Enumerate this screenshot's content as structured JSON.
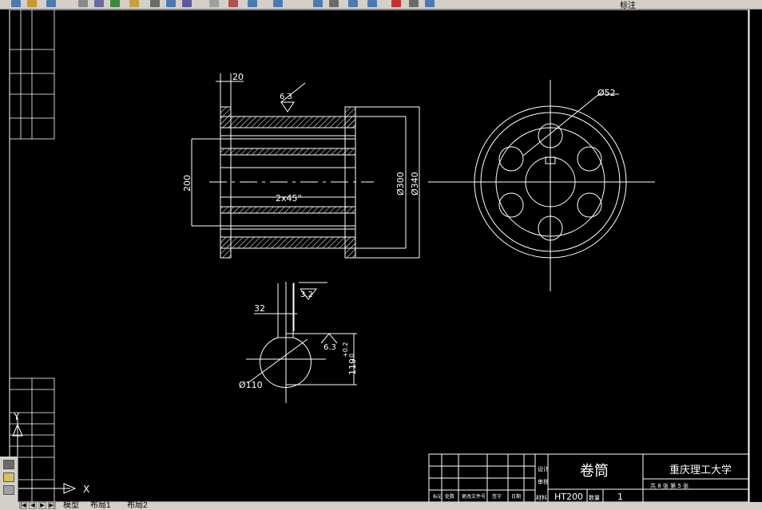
{
  "toolbar": {
    "layer_label": "标注",
    "button_colors": [
      "#4a7ab5",
      "#c89a2a",
      "#4a7ab5",
      "#8a8a8a",
      "#6a6aa0",
      "#3a8a3a",
      "#c8a040",
      "#6a6a6a",
      "#4a7ab5",
      "#5a5a9a",
      "#a0a0a0",
      "#b05050",
      "#4a7ab5",
      "#4a7ab5",
      "#4a7ab5",
      "#6a6a6a",
      "#4a7ab5",
      "#4a7ab5",
      "#c83030",
      "#6a6a6a",
      "#4a7ab5"
    ]
  },
  "drawing": {
    "dims": {
      "d20": "20",
      "roughness_63": "6.3",
      "d200": "200",
      "chamfer": "2x45°",
      "d300": "Ø300",
      "d340": "Ø340",
      "d52": "Ø52",
      "d32": "32",
      "roughness_32": "3.2",
      "roughness_63b": "6.3",
      "d119": "119",
      "tol_upper": "+0.2",
      "tol_lower": "0",
      "d110": "Ø110"
    },
    "title_block": {
      "part_name": "卷筒",
      "company": "重庆理工大学",
      "material": "HT200",
      "quantity": "1",
      "sheet_info": "共 8 张 第 5 张",
      "labels": [
        "标记",
        "处数",
        "更改文件号",
        "签字",
        "日期"
      ],
      "side_labels": [
        "设计",
        "审核"
      ],
      "mat_label": "材料",
      "qty_label": "数量"
    },
    "ucs": {
      "x_label": "X",
      "y_label": "Y"
    }
  },
  "tabs": {
    "items": [
      "模型",
      "布局1",
      "布局2"
    ]
  }
}
